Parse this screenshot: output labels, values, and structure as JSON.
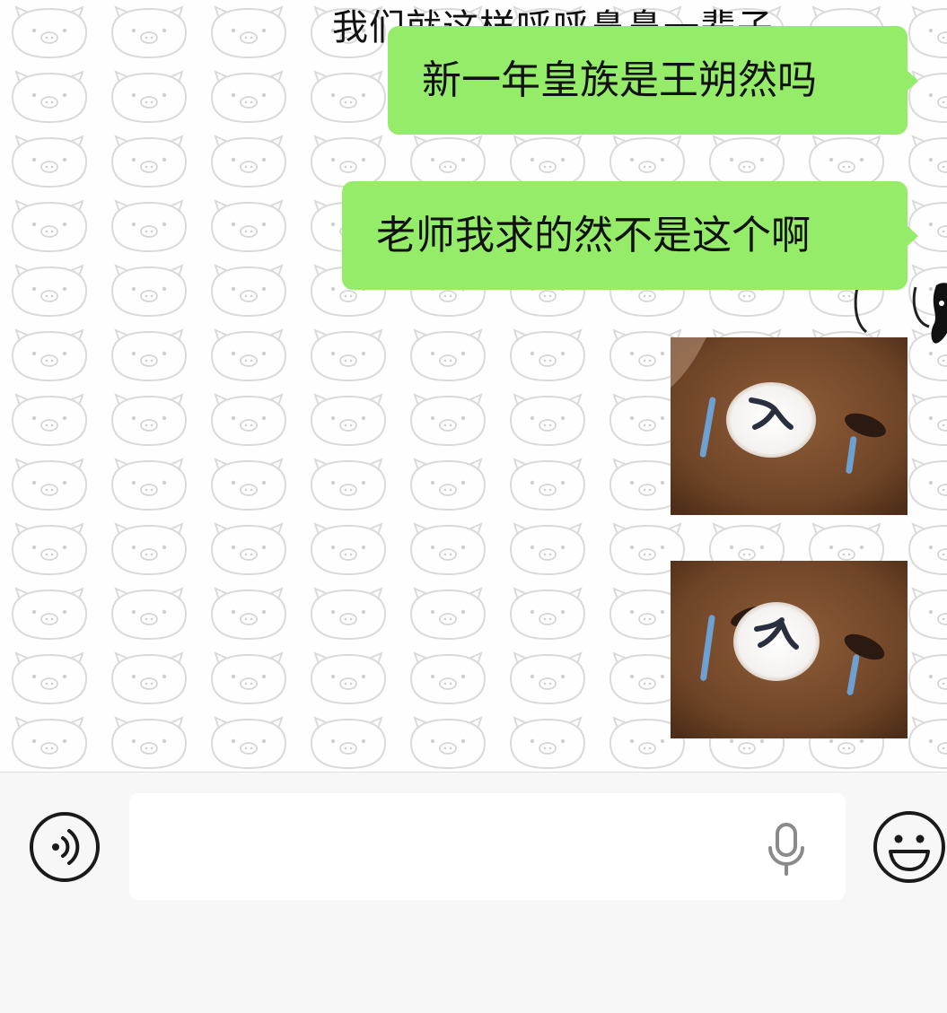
{
  "chat": {
    "background_caption": "我们就这样呼呼鼻鼻一辈子",
    "messages": [
      {
        "type": "text",
        "text": "新一年皇族是王朔然吗",
        "sender": "me"
      },
      {
        "type": "text",
        "text": "老师我求的然不是这个啊",
        "sender": "me"
      },
      {
        "type": "sticker",
        "icon": "crying-bear-sticker-icon",
        "sender": "me"
      },
      {
        "type": "sticker",
        "icon": "crying-bear-sticker-icon",
        "sender": "me"
      }
    ]
  },
  "input_bar": {
    "voice_icon": "voice-mode-icon",
    "input_value": "",
    "mic_icon": "microphone-icon",
    "emoji_icon": "emoji-smile-icon"
  },
  "colors": {
    "bubble_green": "#95ec69",
    "wallpaper_pig_outline": "#d6d6d6",
    "input_bar_bg": "#f7f7f7",
    "sticker_brown": "#7a4f2e"
  }
}
